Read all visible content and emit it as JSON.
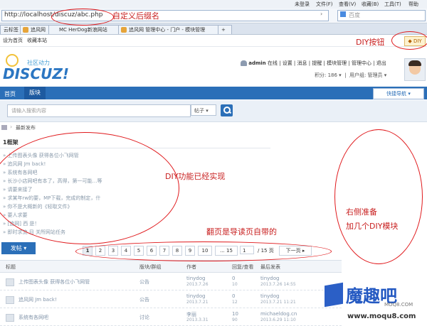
{
  "browser": {
    "menu": [
      "未登录",
      "文件(F)",
      "查看(V)",
      "收藏(B)",
      "工具(T)",
      "帮助"
    ],
    "url": "http://localhost/discuz/abc.php",
    "search_placeholder": "百度",
    "tabs": [
      "云标签",
      "追风网",
      "MC HerDog新浪网站",
      "追风网 管理中心 - 门户 - 模块管理",
      "+"
    ],
    "bookmarks": [
      "设为首页",
      "收藏本站"
    ],
    "diy_label": "DIY"
  },
  "header": {
    "logo_sub": "社区动力",
    "logo": "DISCUZ!",
    "username": "admin",
    "user_links": [
      "在线",
      "设置",
      "消息",
      "提醒",
      "模块管理",
      "管理中心",
      "退出"
    ],
    "points": "积分: 186",
    "usergroup": "用户组: 管理员"
  },
  "nav": {
    "home": "首页",
    "board": "版块",
    "quick_nav": "快捷导航"
  },
  "search": {
    "placeholder": "请输入搜索内容",
    "scope": "帖子"
  },
  "breadcrumb": "最新发布",
  "frame": {
    "title": "1框架",
    "items": [
      "上传图表头像 获得各位小飞网管",
      "追风网 Jm back!",
      "系统有各网吧",
      "长沙小店网吧有本了，高得，第一可能…等",
      "请要来接了",
      "求某年rw的要，MP下载，完成的制定，什",
      "你不是大概新的《轻取文件》",
      "要人求要",
      "[追网] 西 是！",
      "即时求流 目 关所网站任务"
    ]
  },
  "annotations": {
    "url_suffix": "自定义后缀名",
    "diy_button": "DIY按钮",
    "diy_done": "DIY功能已经实现",
    "right_plan_1": "右侧准备",
    "right_plan_2": "加几个DIY模块",
    "pager_note": "翻页是导读页自带的"
  },
  "post_button": "发帖",
  "pager": {
    "pages": [
      "1",
      "2",
      "3",
      "4",
      "5",
      "6",
      "7",
      "8",
      "9",
      "10",
      "... 15"
    ],
    "current": "1",
    "total": "/ 15 页",
    "next": "下一页"
  },
  "table": {
    "headers": [
      "标题",
      "版块/群组",
      "作者",
      "回复/查看",
      "最后发表"
    ],
    "rows": [
      {
        "title": "上传图表头像 获得各位小飞网管",
        "forum": "公告",
        "author": "tinydog",
        "date": "2013.7.26",
        "replies": "0",
        "views": "10",
        "last": "tinydog",
        "last_date": "2013.7.26 14:55"
      },
      {
        "title": "追风网 Jm back!",
        "forum": "公告",
        "author": "tinydog",
        "date": "2013.7.21",
        "replies": "0",
        "views": "12",
        "last": "tinydog",
        "last_date": "2013.7.21 11:21"
      },
      {
        "title": "系统有各网吧",
        "forum": "讨论",
        "author": "李丽",
        "date": "2013.3.31",
        "replies": "10",
        "views": "90",
        "last": "michaeldog.cn",
        "last_date": "2013.6.29 11:10"
      }
    ]
  },
  "watermark": {
    "text": "魔趣吧",
    "sub": "MOQ8.COM",
    "url": "www.moqu8.com"
  }
}
